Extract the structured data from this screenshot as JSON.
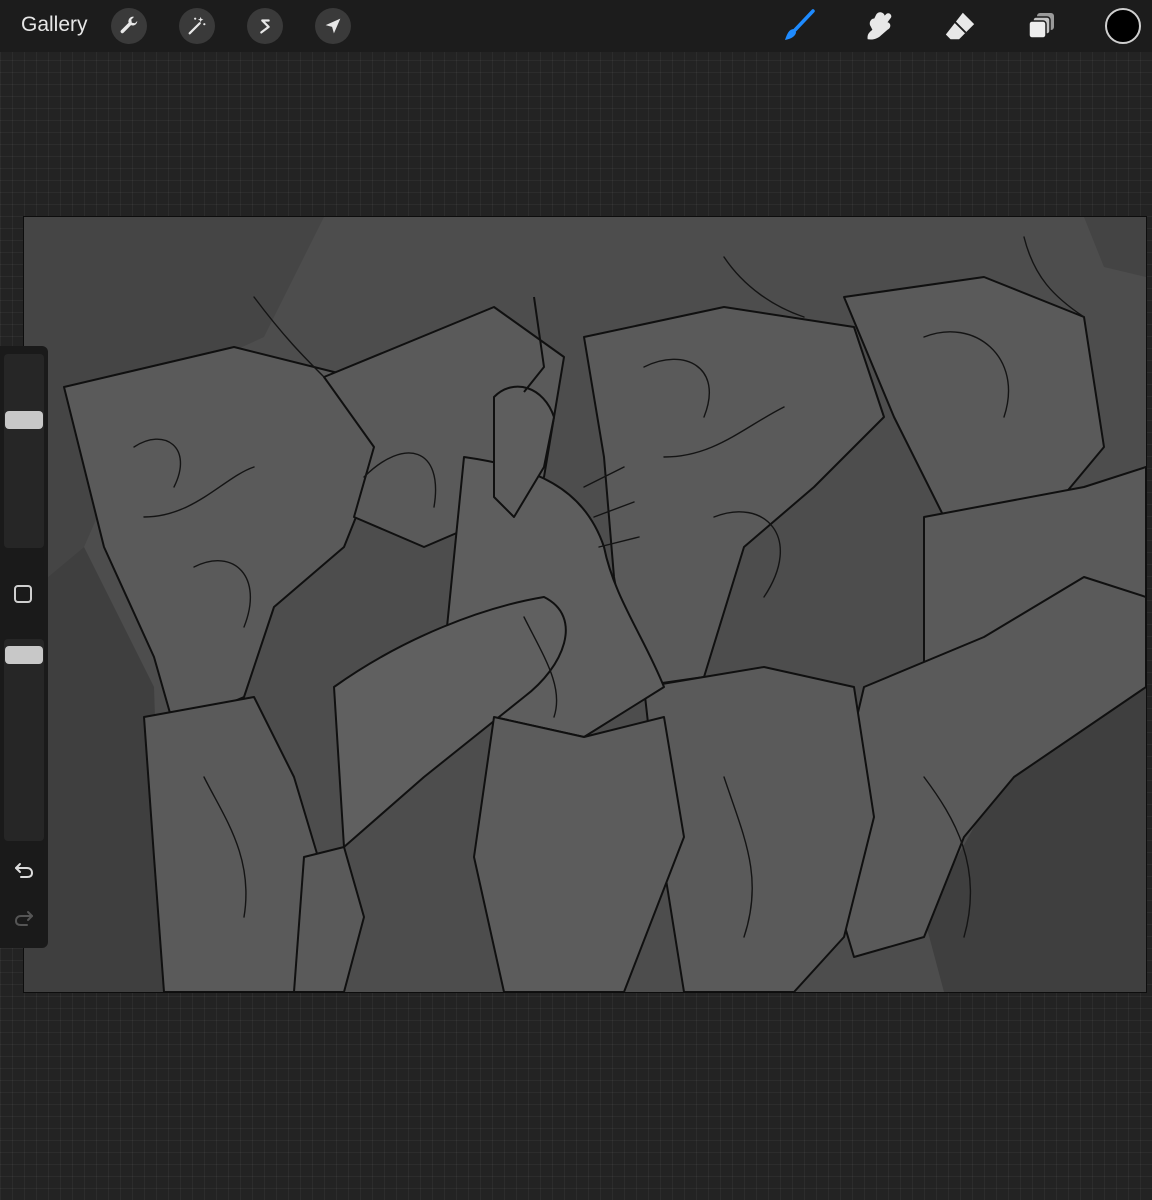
{
  "topbar": {
    "gallery_label": "Gallery",
    "left_icons": [
      "wrench-icon",
      "magic-wand-icon",
      "selection-s-icon",
      "arrow-cursor-icon"
    ],
    "right_icons": [
      "brush-icon",
      "smudge-icon",
      "eraser-icon",
      "layers-icon"
    ],
    "current_color": "#000000"
  },
  "colors": {
    "accent": "#1e8bff",
    "toolbar_bg": "#1c1c1c",
    "canvas_bg": "#4a4a4a",
    "workspace_bg": "#232323"
  },
  "sidebar": {
    "brush_size_level": 0.68,
    "opacity_level": 0.97,
    "buttons": [
      "modify-square-icon",
      "undo-icon",
      "redo-icon"
    ]
  }
}
